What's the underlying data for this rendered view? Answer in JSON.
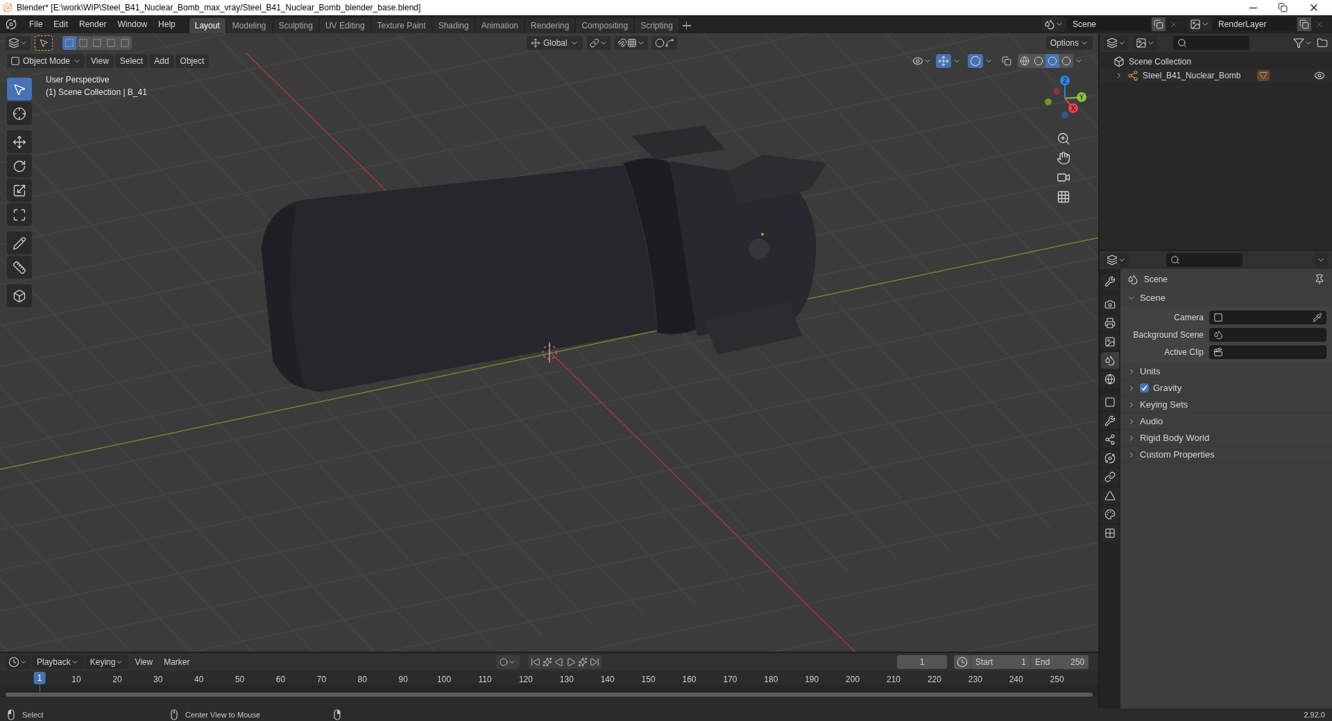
{
  "window": {
    "title": "Blender* [E:\\work\\WIP\\Steel_B41_Nuclear_Bomb_max_vray/Steel_B41_Nuclear_Bomb_blender_base.blend]"
  },
  "menu": [
    "File",
    "Edit",
    "Render",
    "Window",
    "Help"
  ],
  "workspaces": [
    {
      "label": "Layout",
      "selected": true
    },
    {
      "label": "Modeling",
      "selected": false
    },
    {
      "label": "Sculpting",
      "selected": false
    },
    {
      "label": "UV Editing",
      "selected": false
    },
    {
      "label": "Texture Paint",
      "selected": false
    },
    {
      "label": "Shading",
      "selected": false
    },
    {
      "label": "Animation",
      "selected": false
    },
    {
      "label": "Rendering",
      "selected": false
    },
    {
      "label": "Compositing",
      "selected": false
    },
    {
      "label": "Scripting",
      "selected": false
    }
  ],
  "scene": {
    "value": "Scene"
  },
  "view_layer": {
    "value": "RenderLayer"
  },
  "viewport": {
    "select_modes": [
      {
        "selected": true
      },
      {
        "selected": false
      },
      {
        "selected": false
      },
      {
        "selected": false
      },
      {
        "selected": false
      }
    ],
    "orientation": "Global",
    "options": "Options",
    "mode": "Object Mode",
    "menus": [
      "View",
      "Select",
      "Add",
      "Object"
    ],
    "shading": [
      {
        "kind": "wireframe",
        "selected": false
      },
      {
        "kind": "solid",
        "selected": false
      },
      {
        "kind": "material",
        "selected": true
      },
      {
        "kind": "rendered",
        "selected": false
      }
    ],
    "info": [
      "User Perspective",
      "(1) Scene Collection | B_41"
    ],
    "tools": [
      {
        "kind": "select",
        "selected": true
      },
      {
        "kind": "cursor",
        "selected": false
      },
      {
        "kind": "move",
        "selected": false
      },
      {
        "kind": "rotate",
        "selected": false
      },
      {
        "kind": "scale",
        "selected": false
      },
      {
        "kind": "transform",
        "selected": false
      },
      {
        "kind": "annotate",
        "selected": false
      },
      {
        "kind": "measure",
        "selected": false
      },
      {
        "kind": "add_cube",
        "selected": false
      }
    ],
    "axes": [
      {
        "label": "Z",
        "color": "#2f83e6"
      },
      {
        "label": "Y",
        "color": "#8bc43a"
      },
      {
        "label": "X",
        "color": "#e8404f"
      }
    ]
  },
  "outliner": {
    "items": [
      {
        "label": "Scene Collection",
        "children": [
          {
            "label": "Steel_B41_Nuclear_Bomb",
            "expanded": false,
            "visible": true
          }
        ]
      }
    ]
  },
  "properties": {
    "tabs": [
      {
        "kind": "tool",
        "selected": false
      },
      {
        "kind": "render",
        "selected": false
      },
      {
        "kind": "output",
        "selected": false
      },
      {
        "kind": "view_layer",
        "selected": false
      },
      {
        "kind": "scene",
        "selected": true
      },
      {
        "kind": "world",
        "selected": false
      },
      {
        "kind": "object",
        "selected": false
      },
      {
        "kind": "modifiers",
        "selected": false
      },
      {
        "kind": "particles",
        "selected": false
      },
      {
        "kind": "physics",
        "selected": false
      },
      {
        "kind": "constraints",
        "selected": false
      },
      {
        "kind": "data",
        "selected": false
      },
      {
        "kind": "material",
        "selected": false
      },
      {
        "kind": "texture",
        "selected": false
      }
    ],
    "context": "Scene",
    "panel": {
      "title": "Scene",
      "expanded": true,
      "fields": [
        {
          "label": "Camera",
          "kind": "object"
        },
        {
          "label": "Background Scene",
          "kind": "scene"
        },
        {
          "label": "Active Clip",
          "kind": "clip"
        }
      ]
    },
    "subpanels": [
      {
        "label": "Units",
        "kind": "plain"
      },
      {
        "label": "Gravity",
        "kind": "checkbox",
        "checked": true
      },
      {
        "label": "Keying Sets",
        "kind": "plain"
      },
      {
        "label": "Audio",
        "kind": "plain"
      },
      {
        "label": "Rigid Body World",
        "kind": "plain"
      },
      {
        "label": "Custom Properties",
        "kind": "plain"
      }
    ]
  },
  "timeline": {
    "menus": [
      "Playback",
      "Keying",
      "View",
      "Marker"
    ],
    "current_frame": "1",
    "start_label": "Start",
    "start": "1",
    "end_label": "End",
    "end": "250",
    "marker": "1",
    "ticks": [
      "10",
      "20",
      "30",
      "40",
      "50",
      "60",
      "70",
      "80",
      "90",
      "100",
      "110",
      "120",
      "130",
      "140",
      "150",
      "160",
      "170",
      "180",
      "190",
      "200",
      "210",
      "220",
      "230",
      "240",
      "250"
    ]
  },
  "status_bar": {
    "hints": [
      {
        "kind": "left",
        "label": "Select"
      },
      {
        "kind": "middle",
        "label": "Center View to Mouse"
      },
      {
        "kind": "right"
      }
    ],
    "version": "2.92.0"
  }
}
